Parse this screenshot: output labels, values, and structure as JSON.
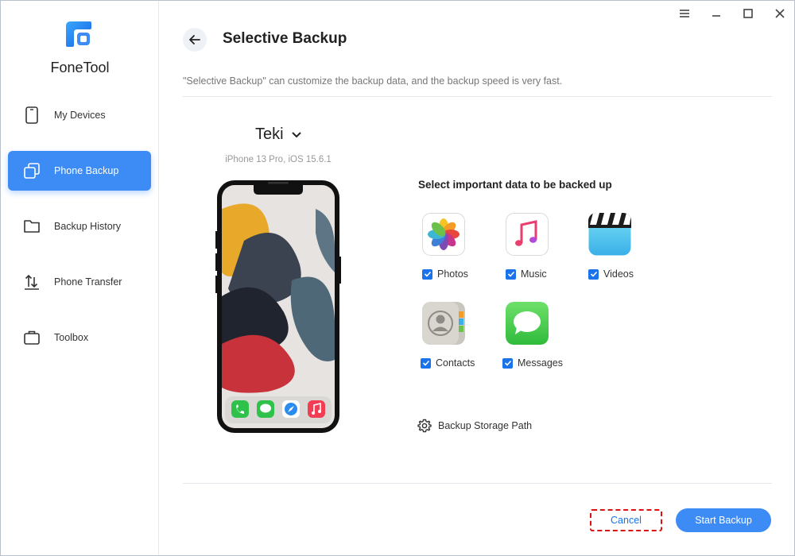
{
  "app": {
    "name": "FoneTool"
  },
  "sidebar": {
    "items": [
      {
        "label": "My Devices",
        "icon": "phone-icon",
        "active": false
      },
      {
        "label": "Phone Backup",
        "icon": "copy-icon",
        "active": true
      },
      {
        "label": "Backup History",
        "icon": "folder-icon",
        "active": false
      },
      {
        "label": "Phone Transfer",
        "icon": "transfer-arrows-icon",
        "active": false
      },
      {
        "label": "Toolbox",
        "icon": "briefcase-icon",
        "active": false
      }
    ]
  },
  "window_controls": [
    "menu-icon",
    "minimize-icon",
    "maximize-icon",
    "close-icon"
  ],
  "header": {
    "title": "Selective Backup",
    "description": "\"Selective Backup\" can customize the backup data, and the backup speed is very fast."
  },
  "device": {
    "name": "Teki",
    "model": "iPhone 13 Pro, iOS 15.6.1"
  },
  "selection": {
    "title": "Select important data to be backed up",
    "items": [
      {
        "label": "Photos",
        "icon": "photos-icon",
        "checked": true
      },
      {
        "label": "Music",
        "icon": "music-icon",
        "checked": true
      },
      {
        "label": "Videos",
        "icon": "videos-icon",
        "checked": true
      },
      {
        "label": "Contacts",
        "icon": "contacts-icon",
        "checked": true
      },
      {
        "label": "Messages",
        "icon": "messages-icon",
        "checked": true
      }
    ]
  },
  "storage": {
    "label": "Backup Storage Path",
    "icon": "gear-icon"
  },
  "footer": {
    "cancel_label": "Cancel",
    "start_label": "Start Backup"
  },
  "colors": {
    "accent": "#3d8cf5",
    "checkbox": "#1a73e8",
    "cancel_border": "#dd1111"
  }
}
